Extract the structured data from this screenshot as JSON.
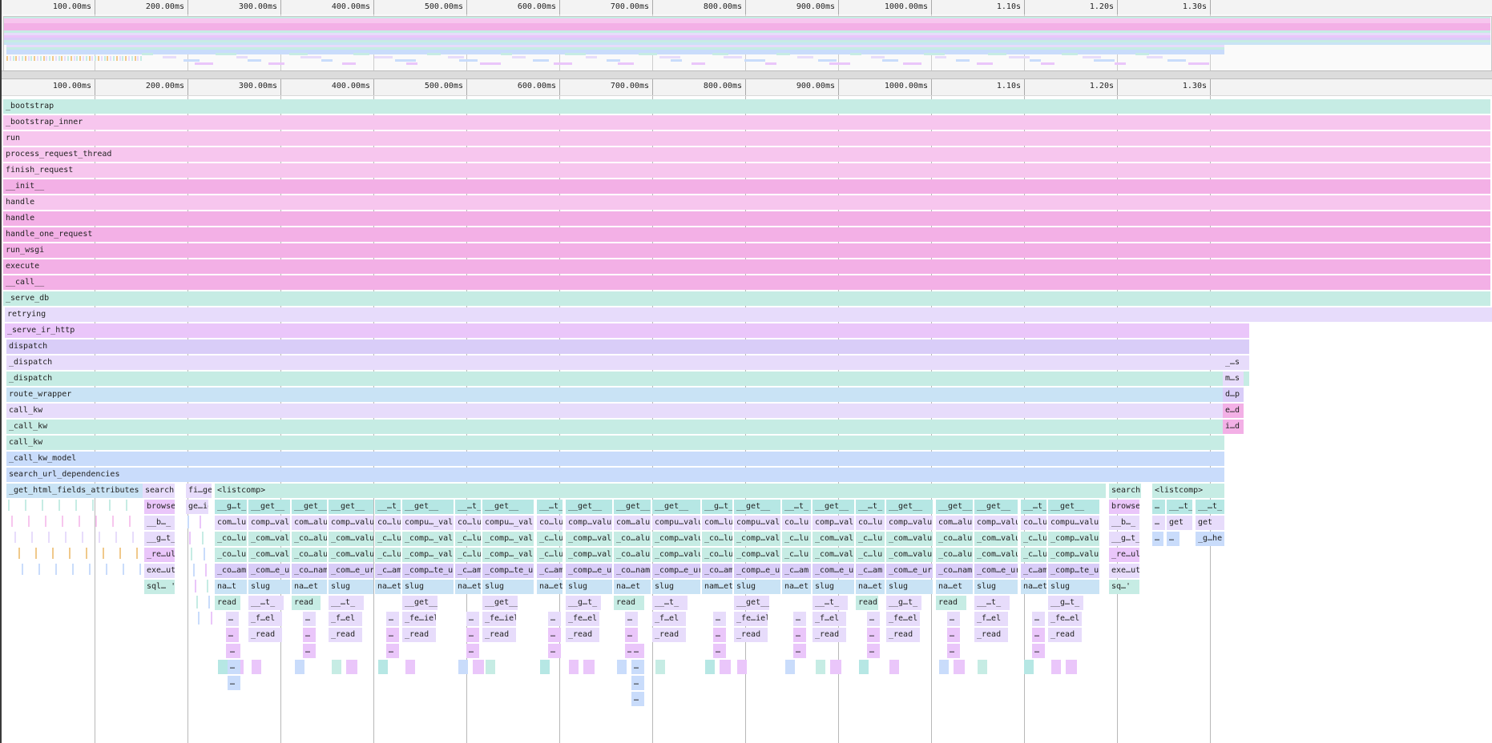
{
  "ruler": {
    "ticks": [
      "100.00ms",
      "200.00ms",
      "300.00ms",
      "400.00ms",
      "500.00ms",
      "600.00ms",
      "700.00ms",
      "800.00ms",
      "900.00ms",
      "1000.00ms",
      "1.10s",
      "1.20s",
      "1.30s"
    ]
  },
  "palette": {
    "teal": "#c6ece4",
    "pink": "#f7c6ee",
    "pink_strong": "#f3b0e6",
    "lavender": "#e7dcfb",
    "purple": "#d9cdf8",
    "violet": "#eac6fa",
    "blue": "#c9e3f5",
    "sky": "#c9dcfb",
    "aqua": "#b6e7e4"
  },
  "frames": [
    {
      "label": "_bootstrap",
      "color": "teal"
    },
    {
      "label": "_bootstrap_inner",
      "color": "pink"
    },
    {
      "label": "run",
      "color": "pink"
    },
    {
      "label": "process_request_thread",
      "color": "pink"
    },
    {
      "label": "finish_request",
      "color": "pink"
    },
    {
      "label": "__init__",
      "color": "pink_strong"
    },
    {
      "label": "handle",
      "color": "pink"
    },
    {
      "label": "handle",
      "color": "pink_strong"
    },
    {
      "label": "handle_one_request",
      "color": "pink_strong"
    },
    {
      "label": "run_wsgi",
      "color": "pink_strong"
    },
    {
      "label": "execute",
      "color": "pink_strong"
    },
    {
      "label": "__call__",
      "color": "pink_strong"
    },
    {
      "label": "_serve_db",
      "color": "teal"
    },
    {
      "label": "retrying",
      "color": "lavender"
    },
    {
      "label": "_serve_ir_http",
      "color": "violet"
    },
    {
      "label": "dispatch",
      "color": "purple"
    },
    {
      "label": "_dispatch",
      "color": "lavender"
    },
    {
      "label": "_dispatch",
      "color": "teal"
    },
    {
      "label": "route_wrapper",
      "color": "blue"
    },
    {
      "label": "call_kw",
      "color": "lavender"
    },
    {
      "label": "_call_kw",
      "color": "teal"
    },
    {
      "label": "call_kw",
      "color": "teal"
    },
    {
      "label": "_call_kw_model",
      "color": "sky"
    },
    {
      "label": "search_url_dependencies",
      "color": "sky"
    }
  ],
  "right_side_frames": [
    "_…s",
    "m…s",
    "d…p",
    "e…d",
    "i…d"
  ],
  "level25": [
    "_get_html_fields_attributes",
    "search",
    "fi…ge",
    "<listcomp>",
    "search",
    "<listcomp>"
  ],
  "listcomp_columns": [
    {
      "l1": "__g…t_",
      "l2": "com…lu",
      "l3": "_co…lu",
      "l4": "_co…lu",
      "l5": "_co…am",
      "l6": "na…t",
      "l7": "read",
      "l8": "…",
      "l9": "…",
      "l10": "…",
      "l11": "…",
      "l12": "…"
    },
    {
      "l1": "__get__",
      "l2": "comp…valu",
      "l3": "_com…valu",
      "l4": "_com…valu",
      "l5": "_com…e_ur",
      "l6": "slug",
      "l7": "__…t_",
      "l8": "_f…el",
      "l9": "_read",
      "l10": ""
    },
    {
      "l1": "__get__",
      "l2": "com…alu",
      "l3": "_co…alu",
      "l4": "_co…alu",
      "l5": "_co…nam",
      "l6": "na…et",
      "l7": "read",
      "l8": "…",
      "l9": "…",
      "l10": "…"
    },
    {
      "l1": "__get__",
      "l2": "comp…valu",
      "l3": "_com…valu",
      "l4": "_com…valu",
      "l5": "_com…e_ur",
      "l6": "slug",
      "l7": "__…t_",
      "l8": "_f…el",
      "l9": "_read",
      "l10": ""
    },
    {
      "l1": "__…t_",
      "l2": "co…lu",
      "l3": "_c…lu",
      "l4": "_c…lu",
      "l5": "_c…am",
      "l6": "na…et",
      "l7": "",
      "l8": "…",
      "l9": "…",
      "l10": "…"
    },
    {
      "l1": "__get__",
      "l2": "compu…_valu",
      "l3": "_comp…_valu",
      "l4": "_comp…_valu",
      "l5": "_comp…te_ur",
      "l6": "slug",
      "l7": "__get__",
      "l8": "_fe…iel",
      "l9": "_read",
      "l10": ""
    },
    {
      "l1": "__…t_",
      "l2": "co…lu",
      "l3": "_c…lu",
      "l4": "_c…lu",
      "l5": "_c…am",
      "l6": "na…et",
      "l7": "",
      "l8": "…",
      "l9": "…",
      "l10": "…"
    },
    {
      "l1": "__get__",
      "l2": "compu…_valu",
      "l3": "_comp…_valu",
      "l4": "_comp…_valu",
      "l5": "_comp…te_ur",
      "l6": "slug",
      "l7": "__get__",
      "l8": "_fe…iel",
      "l9": "_read",
      "l10": ""
    },
    {
      "l1": "__…t_",
      "l2": "co…lu",
      "l3": "_c…lu",
      "l4": "_c…lu",
      "l5": "_c…am",
      "l6": "na…et",
      "l7": "",
      "l8": "…",
      "l9": "…",
      "l10": "…"
    },
    {
      "l1": "__get__",
      "l2": "comp…valu",
      "l3": "_comp…valu",
      "l4": "_comp…valu",
      "l5": "_comp…e_ur",
      "l6": "slug",
      "l7": "__g…t_",
      "l8": "_fe…el",
      "l9": "_read",
      "l10": ""
    },
    {
      "l1": "__get__",
      "l2": "com…alu",
      "l3": "_co…alu",
      "l4": "_co…alu",
      "l5": "_co…nam",
      "l6": "na…et",
      "l7": "read",
      "l8": "…",
      "l9": "…",
      "l10": "…"
    },
    {
      "l1": "__get__",
      "l2": "compu…valu",
      "l3": "_comp…valu",
      "l4": "_comp…valu",
      "l5": "_comp…e_ur",
      "l6": "slug",
      "l7": "__…t_",
      "l8": "_f…el",
      "l9": "_read",
      "l10": ""
    },
    {
      "l1": "__g…t_",
      "l2": "com…lu",
      "l3": "_co…lu",
      "l4": "_co…lu",
      "l5": "_co…am",
      "l6": "nam…et",
      "l7": "",
      "l8": "…",
      "l9": "…",
      "l10": "…"
    },
    {
      "l1": "__get__",
      "l2": "compu…valu",
      "l3": "_comp…valu",
      "l4": "_comp…valu",
      "l5": "_comp…e_ur",
      "l6": "slug",
      "l7": "__get__",
      "l8": "_fe…iel",
      "l9": "_read",
      "l10": ""
    },
    {
      "l1": "__…t_",
      "l2": "co…lu",
      "l3": "_c…lu",
      "l4": "_c…lu",
      "l5": "_c…am",
      "l6": "na…et",
      "l7": "",
      "l8": "…",
      "l9": "…",
      "l10": "…"
    },
    {
      "l1": "__get__",
      "l2": "comp…valu",
      "l3": "_com…valu",
      "l4": "_com…valu",
      "l5": "_com…e_ur",
      "l6": "slug",
      "l7": "__…t_",
      "l8": "_f…el",
      "l9": "_read",
      "l10": ""
    },
    {
      "l1": "__…t_",
      "l2": "co…lu",
      "l3": "_c…lu",
      "l4": "_c…lu",
      "l5": "_c…am",
      "l6": "na…et",
      "l7": "read",
      "l8": "…",
      "l9": "…",
      "l10": "…"
    },
    {
      "l1": "__get__",
      "l2": "comp…valu",
      "l3": "_com…valu",
      "l4": "_com…valu",
      "l5": "_com…e_ur",
      "l6": "slug",
      "l7": "__g…t_",
      "l8": "_fe…el",
      "l9": "_read",
      "l10": ""
    },
    {
      "l1": "__get__",
      "l2": "com…alu",
      "l3": "_co…alu",
      "l4": "_co…alu",
      "l5": "_co…nam",
      "l6": "na…et",
      "l7": "read",
      "l8": "…",
      "l9": "…",
      "l10": "…"
    },
    {
      "l1": "__get__",
      "l2": "comp…valu",
      "l3": "_com…valu",
      "l4": "_com…valu",
      "l5": "_com…e_ur",
      "l6": "slug",
      "l7": "__…t_",
      "l8": "_f…el",
      "l9": "_read",
      "l10": ""
    },
    {
      "l1": "__…t_",
      "l2": "co…lu",
      "l3": "_c…lu",
      "l4": "_c…lu",
      "l5": "_c…am",
      "l6": "na…et",
      "l7": "",
      "l8": "…",
      "l9": "…",
      "l10": "…"
    },
    {
      "l1": "__get__",
      "l2": "compu…valu",
      "l3": "_comp…valu",
      "l4": "_comp…valu",
      "l5": "_comp…te_ur",
      "l6": "slug",
      "l7": "__g…t_",
      "l8": "_fe…el",
      "l9": "_read",
      "l10": ""
    }
  ],
  "search_column": {
    "l1": "browse",
    "l2": "__b…_",
    "l3": "__g…t_",
    "l4": "_re…ul",
    "l5": "exe…ut",
    "l6": "sql… '"
  },
  "search2_column": {
    "l1": "browse",
    "l2": "__b…_",
    "l3": "__g…t_",
    "l4": "_re…ul",
    "l5": "exe…ut",
    "l6": "sq…'"
  },
  "fige_column": {
    "l1": "ge…io"
  },
  "tail_listcomp": {
    "a": "…",
    "b": "__…t_",
    "c": "__…t_",
    "d": "…",
    "e": "get",
    "f": "get",
    "g": "…",
    "h": "…",
    "i": "_g…he"
  }
}
